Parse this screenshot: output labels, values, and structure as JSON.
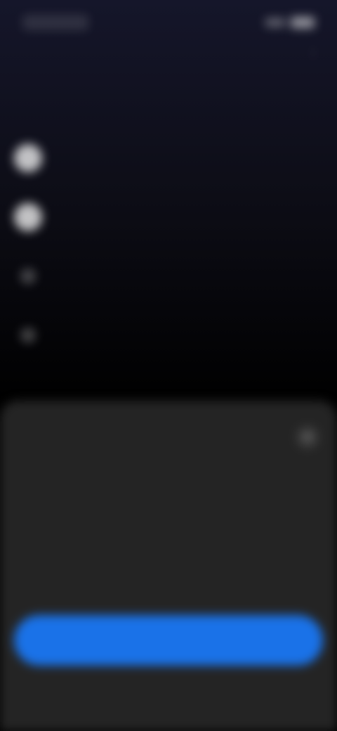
{
  "status": {
    "time": ""
  },
  "header": {
    "subtitle": "",
    "menu_icon": "more-vert-icon"
  },
  "main": {
    "heading": "",
    "items": [
      {
        "title": "",
        "description": ""
      },
      {
        "title": "",
        "description": ""
      },
      {
        "title": "",
        "description": ""
      },
      {
        "title": "",
        "description": ""
      }
    ]
  },
  "sheet": {
    "close_icon": "close-icon",
    "title": "",
    "description": "",
    "description_link": "",
    "option_left": "",
    "option_right": "",
    "note": "",
    "primary_button": "",
    "secondary_button": ""
  },
  "colors": {
    "accent": "#1a72e8",
    "sheet_bg": "#242424"
  }
}
